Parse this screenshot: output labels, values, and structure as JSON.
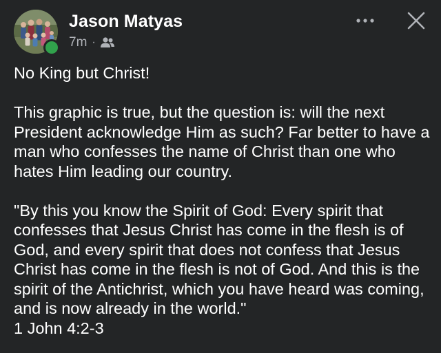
{
  "post": {
    "author": "Jason Matyas",
    "time": "7m",
    "separator": "·",
    "audience_icon": "friends-icon",
    "more_icon": "more-options-icon",
    "close_icon": "close-icon",
    "avatar": "family-photo-avatar",
    "online_status_color": "#31a24c",
    "paragraphs": [
      "No King but Christ!",
      "This graphic is true, but the question is: will the next President acknowledge Him as such?  Far better to have a man who confesses the name of Christ than one who hates Him leading our country.",
      "\"By this you know the Spirit of God: Every spirit that confesses that Jesus Christ has come in the flesh is of God, and every spirit that does not confess that Jesus Christ has come in the flesh is not of God. And this is the spirit of the Antichrist, which you have heard was coming, and is now already in the world.\"\n1 John 4:2-3"
    ]
  },
  "colors": {
    "background": "#232526",
    "text_primary": "#ffffff",
    "text_secondary": "#b0b3b8"
  }
}
